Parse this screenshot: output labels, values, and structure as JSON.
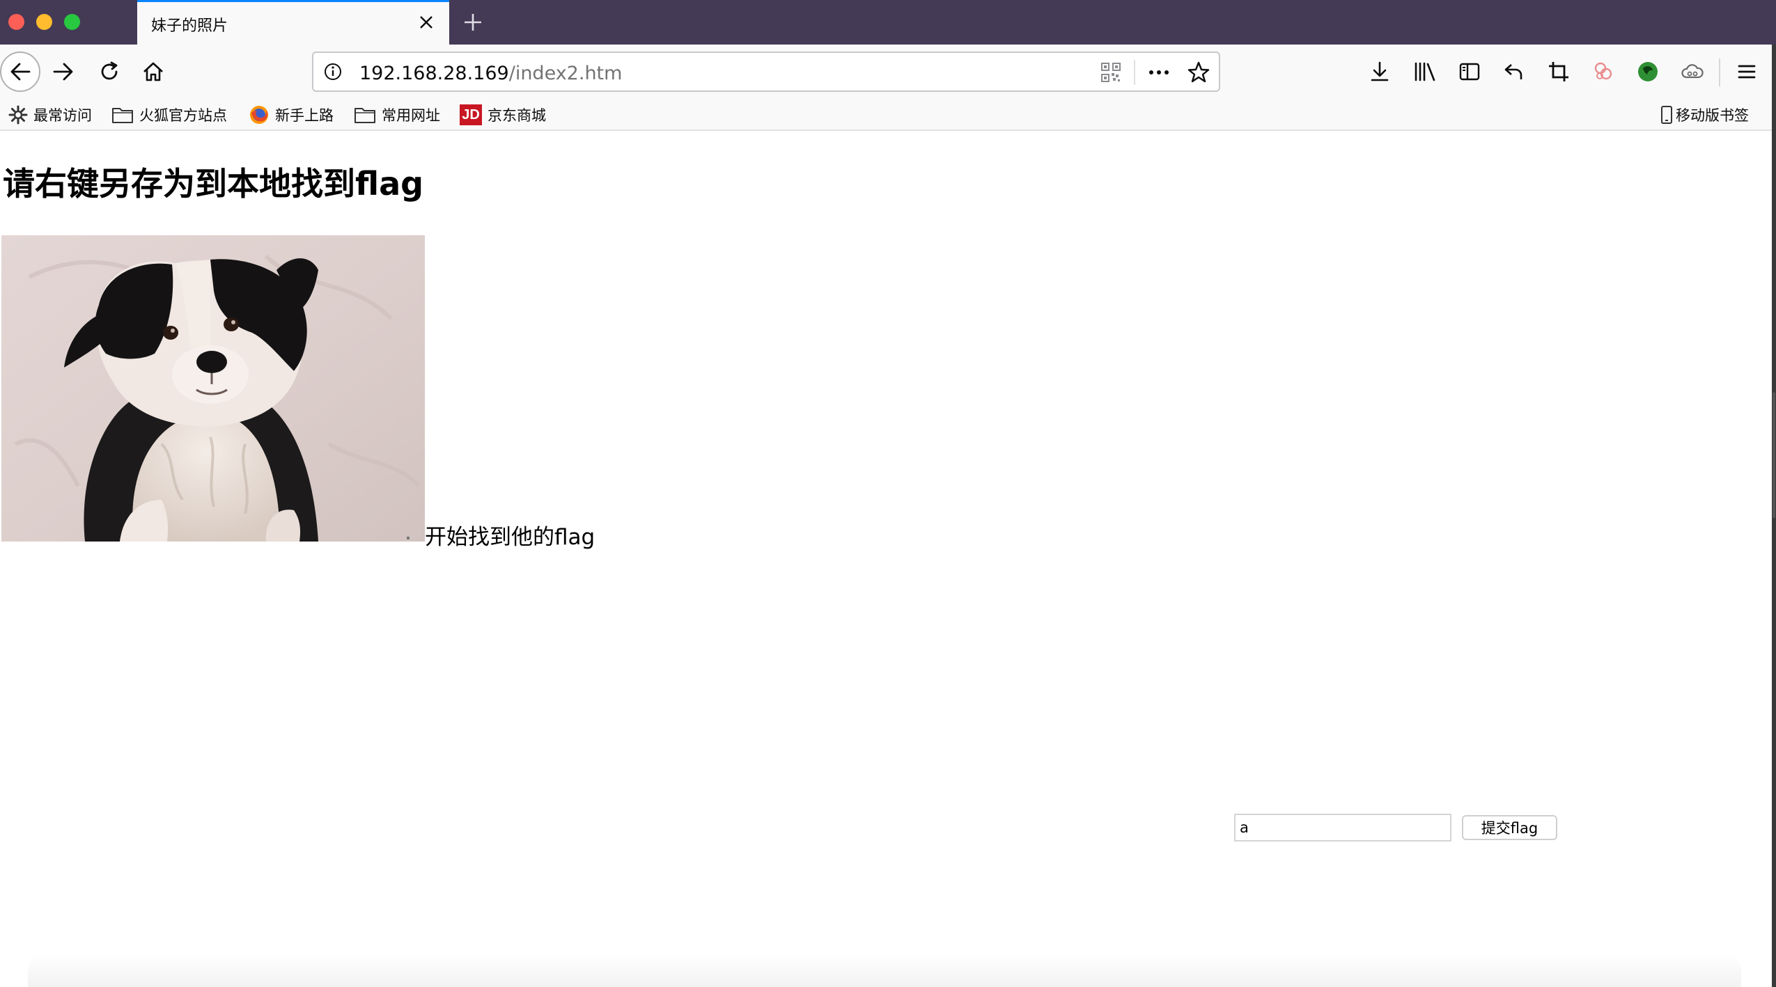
{
  "browser": {
    "tab": {
      "title": "妹子的照片",
      "close_icon": "close-icon"
    },
    "new_tab_icon": "plus-icon",
    "accent_color": "#0a84ff",
    "titlebar_color": "#443a55",
    "nav": {
      "back_icon": "arrow-left-icon",
      "forward_icon": "arrow-right-icon",
      "reload_icon": "reload-icon",
      "home_icon": "home-icon"
    },
    "url": {
      "host": "192.168.28.169",
      "path": "/index2.htm",
      "info_icon": "info-icon",
      "qr_icon": "qr-code-icon",
      "more_icon": "ellipsis-icon",
      "bookmark_icon": "star-icon"
    },
    "toolbar_icons": [
      "download-icon",
      "library-icon",
      "sidebar-icon",
      "undo-icon",
      "crop-icon",
      "extension-icon",
      "green-circle-icon",
      "cloud-icon",
      "menu-icon"
    ],
    "bookmarks": [
      {
        "label": "最常访问",
        "icon": "gear-icon"
      },
      {
        "label": "火狐官方站点",
        "icon": "folder-icon"
      },
      {
        "label": "新手上路",
        "icon": "firefox-icon"
      },
      {
        "label": "常用网址",
        "icon": "folder-icon"
      },
      {
        "label": "京东商城",
        "icon": "jd-logo-icon",
        "logo_text": "JD"
      }
    ],
    "mobile_bookmarks": {
      "label": "移动版书签",
      "icon": "mobile-icon"
    }
  },
  "page": {
    "heading": "请右键另存为到本地找到flag",
    "image": {
      "subject": "puppy-photo"
    },
    "caption": "开始找到他的flag",
    "form": {
      "input_value": "a",
      "submit_label": "提交flag"
    }
  }
}
